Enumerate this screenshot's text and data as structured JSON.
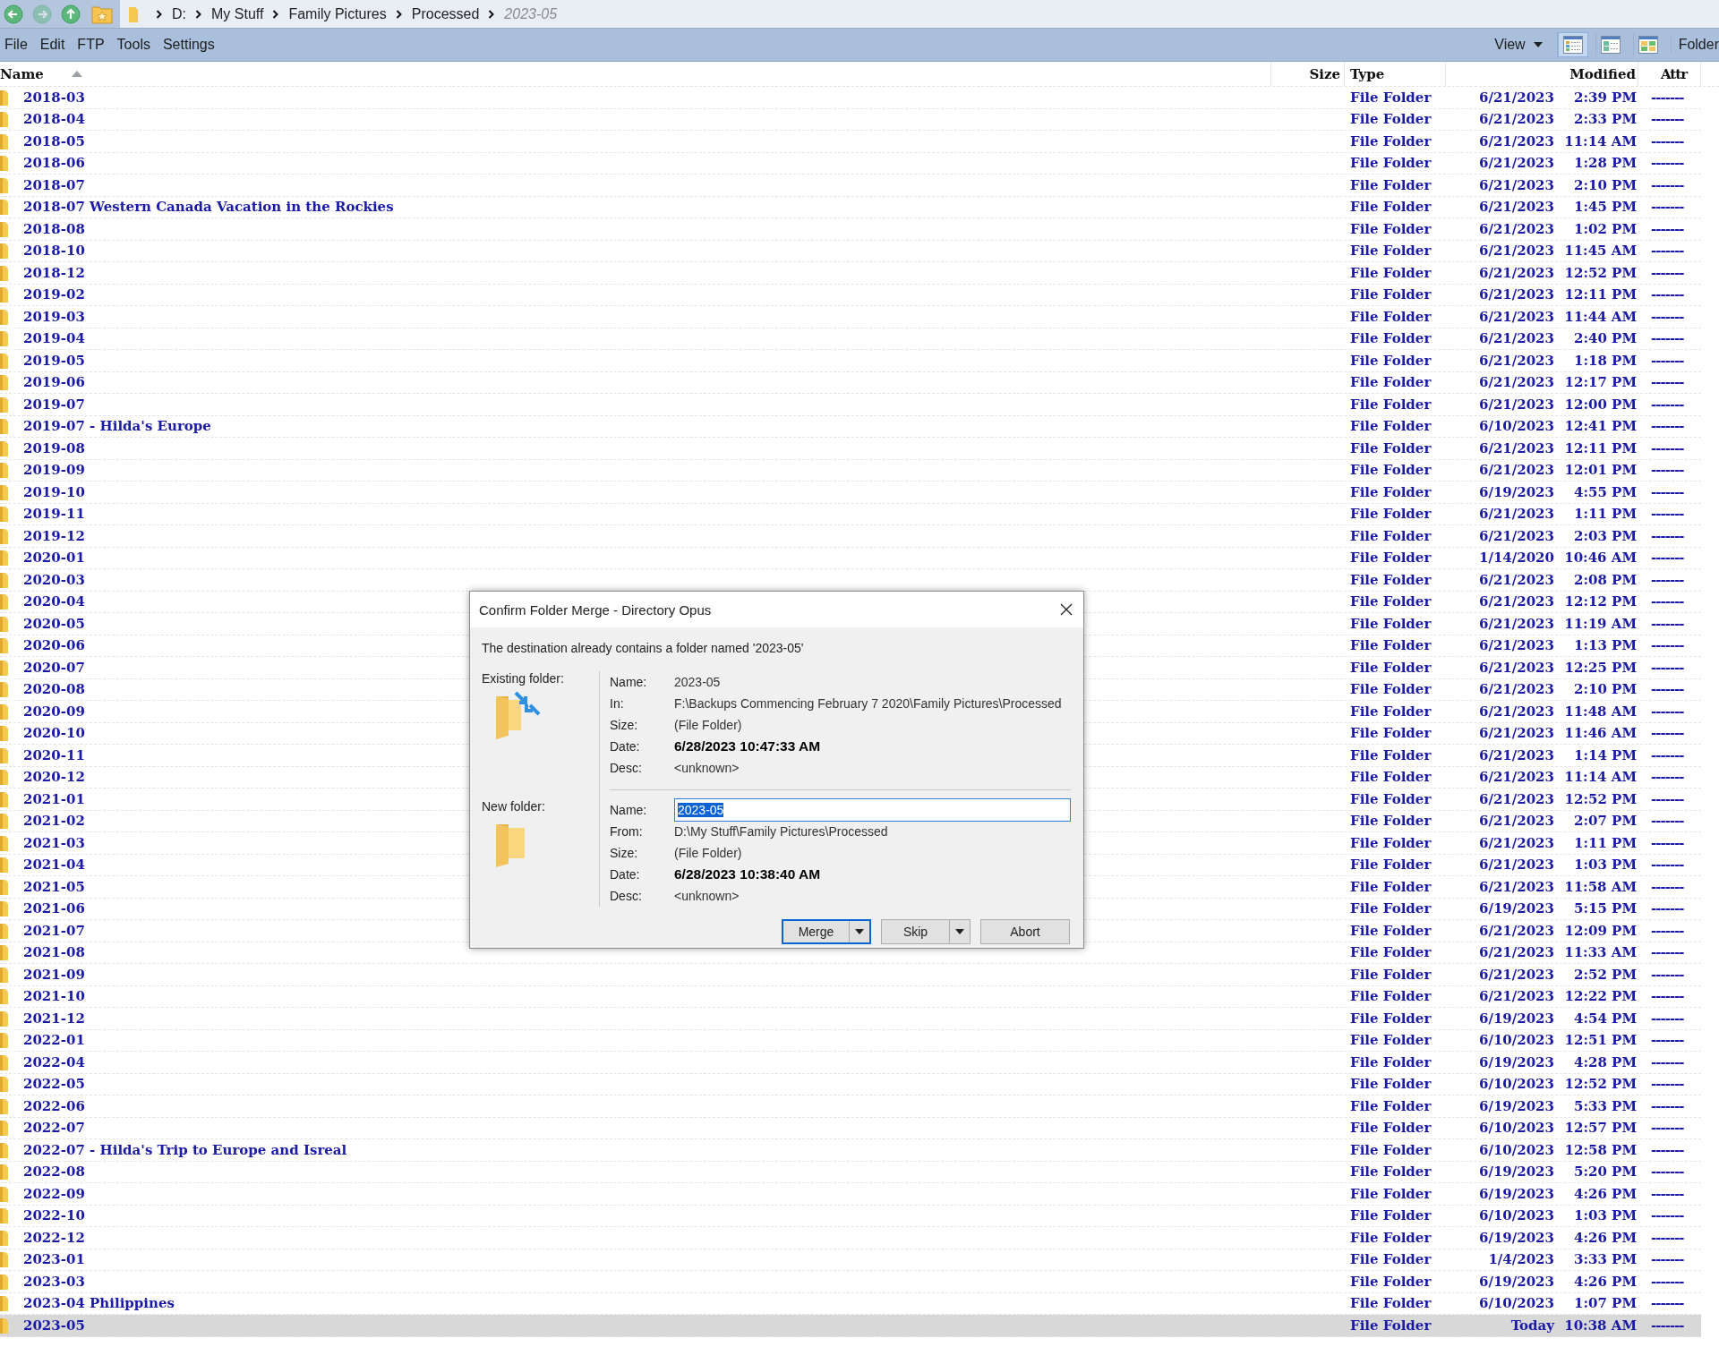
{
  "toolbar": {
    "buttons": [
      {
        "kind": "back",
        "disabled": false
      },
      {
        "kind": "forward",
        "disabled": true
      },
      {
        "kind": "up",
        "disabled": false
      },
      {
        "kind": "favorites",
        "disabled": false
      }
    ]
  },
  "breadcrumb": [
    {
      "label": "D:",
      "current": false
    },
    {
      "label": "My Stuff",
      "current": false
    },
    {
      "label": "Family Pictures",
      "current": false
    },
    {
      "label": "Processed",
      "current": false
    },
    {
      "label": "2023-05",
      "current": true
    }
  ],
  "menu": [
    "File",
    "Edit",
    "FTP",
    "Tools",
    "Settings"
  ],
  "view_menu": "View",
  "layouts": [
    {
      "kind": "details",
      "selected": true
    },
    {
      "kind": "power",
      "selected": false
    },
    {
      "kind": "thumbnails",
      "selected": false
    }
  ],
  "folder_button": "Folder",
  "columns": [
    {
      "kind": "name",
      "label": "Name",
      "sorted": true
    },
    {
      "kind": "size",
      "label": "Size",
      "sorted": false
    },
    {
      "kind": "type",
      "label": "Type",
      "sorted": false
    },
    {
      "kind": "modified",
      "label": "Modified",
      "sorted": false
    },
    {
      "kind": "attr",
      "label": "Attr",
      "sorted": false
    }
  ],
  "rows": [
    {
      "name": "2018-03",
      "type": "File Folder",
      "date": "6/21/2023",
      "time": "2:39 PM",
      "attr": "-------",
      "selected": false
    },
    {
      "name": "2018-04",
      "type": "File Folder",
      "date": "6/21/2023",
      "time": "2:33 PM",
      "attr": "-------",
      "selected": false
    },
    {
      "name": "2018-05",
      "type": "File Folder",
      "date": "6/21/2023",
      "time": "11:14 AM",
      "attr": "-------",
      "selected": false
    },
    {
      "name": "2018-06",
      "type": "File Folder",
      "date": "6/21/2023",
      "time": "1:28 PM",
      "attr": "-------",
      "selected": false
    },
    {
      "name": "2018-07",
      "type": "File Folder",
      "date": "6/21/2023",
      "time": "2:10 PM",
      "attr": "-------",
      "selected": false
    },
    {
      "name": "2018-07 Western Canada Vacation in the Rockies",
      "type": "File Folder",
      "date": "6/21/2023",
      "time": "1:45 PM",
      "attr": "-------",
      "selected": false
    },
    {
      "name": "2018-08",
      "type": "File Folder",
      "date": "6/21/2023",
      "time": "1:02 PM",
      "attr": "-------",
      "selected": false
    },
    {
      "name": "2018-10",
      "type": "File Folder",
      "date": "6/21/2023",
      "time": "11:45 AM",
      "attr": "-------",
      "selected": false
    },
    {
      "name": "2018-12",
      "type": "File Folder",
      "date": "6/21/2023",
      "time": "12:52 PM",
      "attr": "-------",
      "selected": false
    },
    {
      "name": "2019-02",
      "type": "File Folder",
      "date": "6/21/2023",
      "time": "12:11 PM",
      "attr": "-------",
      "selected": false
    },
    {
      "name": "2019-03",
      "type": "File Folder",
      "date": "6/21/2023",
      "time": "11:44 AM",
      "attr": "-------",
      "selected": false
    },
    {
      "name": "2019-04",
      "type": "File Folder",
      "date": "6/21/2023",
      "time": "2:40 PM",
      "attr": "-------",
      "selected": false
    },
    {
      "name": "2019-05",
      "type": "File Folder",
      "date": "6/21/2023",
      "time": "1:18 PM",
      "attr": "-------",
      "selected": false
    },
    {
      "name": "2019-06",
      "type": "File Folder",
      "date": "6/21/2023",
      "time": "12:17 PM",
      "attr": "-------",
      "selected": false
    },
    {
      "name": "2019-07",
      "type": "File Folder",
      "date": "6/21/2023",
      "time": "12:00 PM",
      "attr": "-------",
      "selected": false
    },
    {
      "name": "2019-07 - Hilda's Europe",
      "type": "File Folder",
      "date": "6/10/2023",
      "time": "12:41 PM",
      "attr": "-------",
      "selected": false
    },
    {
      "name": "2019-08",
      "type": "File Folder",
      "date": "6/21/2023",
      "time": "12:11 PM",
      "attr": "-------",
      "selected": false
    },
    {
      "name": "2019-09",
      "type": "File Folder",
      "date": "6/21/2023",
      "time": "12:01 PM",
      "attr": "-------",
      "selected": false
    },
    {
      "name": "2019-10",
      "type": "File Folder",
      "date": "6/19/2023",
      "time": "4:55 PM",
      "attr": "-------",
      "selected": false
    },
    {
      "name": "2019-11",
      "type": "File Folder",
      "date": "6/21/2023",
      "time": "1:11 PM",
      "attr": "-------",
      "selected": false
    },
    {
      "name": "2019-12",
      "type": "File Folder",
      "date": "6/21/2023",
      "time": "2:03 PM",
      "attr": "-------",
      "selected": false
    },
    {
      "name": "2020-01",
      "type": "File Folder",
      "date": "1/14/2020",
      "time": "10:46 AM",
      "attr": "-------",
      "selected": false
    },
    {
      "name": "2020-03",
      "type": "File Folder",
      "date": "6/21/2023",
      "time": "2:08 PM",
      "attr": "-------",
      "selected": false
    },
    {
      "name": "2020-04",
      "type": "File Folder",
      "date": "6/21/2023",
      "time": "12:12 PM",
      "attr": "-------",
      "selected": false
    },
    {
      "name": "2020-05",
      "type": "File Folder",
      "date": "6/21/2023",
      "time": "11:19 AM",
      "attr": "-------",
      "selected": false
    },
    {
      "name": "2020-06",
      "type": "File Folder",
      "date": "6/21/2023",
      "time": "1:13 PM",
      "attr": "-------",
      "selected": false
    },
    {
      "name": "2020-07",
      "type": "File Folder",
      "date": "6/21/2023",
      "time": "12:25 PM",
      "attr": "-------",
      "selected": false
    },
    {
      "name": "2020-08",
      "type": "File Folder",
      "date": "6/21/2023",
      "time": "2:10 PM",
      "attr": "-------",
      "selected": false
    },
    {
      "name": "2020-09",
      "type": "File Folder",
      "date": "6/21/2023",
      "time": "11:48 AM",
      "attr": "-------",
      "selected": false
    },
    {
      "name": "2020-10",
      "type": "File Folder",
      "date": "6/21/2023",
      "time": "11:46 AM",
      "attr": "-------",
      "selected": false
    },
    {
      "name": "2020-11",
      "type": "File Folder",
      "date": "6/21/2023",
      "time": "1:14 PM",
      "attr": "-------",
      "selected": false
    },
    {
      "name": "2020-12",
      "type": "File Folder",
      "date": "6/21/2023",
      "time": "11:14 AM",
      "attr": "-------",
      "selected": false
    },
    {
      "name": "2021-01",
      "type": "File Folder",
      "date": "6/21/2023",
      "time": "12:52 PM",
      "attr": "-------",
      "selected": false
    },
    {
      "name": "2021-02",
      "type": "File Folder",
      "date": "6/21/2023",
      "time": "2:07 PM",
      "attr": "-------",
      "selected": false
    },
    {
      "name": "2021-03",
      "type": "File Folder",
      "date": "6/21/2023",
      "time": "1:11 PM",
      "attr": "-------",
      "selected": false
    },
    {
      "name": "2021-04",
      "type": "File Folder",
      "date": "6/21/2023",
      "time": "1:03 PM",
      "attr": "-------",
      "selected": false
    },
    {
      "name": "2021-05",
      "type": "File Folder",
      "date": "6/21/2023",
      "time": "11:58 AM",
      "attr": "-------",
      "selected": false
    },
    {
      "name": "2021-06",
      "type": "File Folder",
      "date": "6/19/2023",
      "time": "5:15 PM",
      "attr": "-------",
      "selected": false
    },
    {
      "name": "2021-07",
      "type": "File Folder",
      "date": "6/21/2023",
      "time": "12:09 PM",
      "attr": "-------",
      "selected": false
    },
    {
      "name": "2021-08",
      "type": "File Folder",
      "date": "6/21/2023",
      "time": "11:33 AM",
      "attr": "-------",
      "selected": false
    },
    {
      "name": "2021-09",
      "type": "File Folder",
      "date": "6/21/2023",
      "time": "2:52 PM",
      "attr": "-------",
      "selected": false
    },
    {
      "name": "2021-10",
      "type": "File Folder",
      "date": "6/21/2023",
      "time": "12:22 PM",
      "attr": "-------",
      "selected": false
    },
    {
      "name": "2021-12",
      "type": "File Folder",
      "date": "6/19/2023",
      "time": "4:54 PM",
      "attr": "-------",
      "selected": false
    },
    {
      "name": "2022-01",
      "type": "File Folder",
      "date": "6/10/2023",
      "time": "12:51 PM",
      "attr": "-------",
      "selected": false
    },
    {
      "name": "2022-04",
      "type": "File Folder",
      "date": "6/19/2023",
      "time": "4:28 PM",
      "attr": "-------",
      "selected": false
    },
    {
      "name": "2022-05",
      "type": "File Folder",
      "date": "6/10/2023",
      "time": "12:52 PM",
      "attr": "-------",
      "selected": false
    },
    {
      "name": "2022-06",
      "type": "File Folder",
      "date": "6/19/2023",
      "time": "5:33 PM",
      "attr": "-------",
      "selected": false
    },
    {
      "name": "2022-07",
      "type": "File Folder",
      "date": "6/10/2023",
      "time": "12:57 PM",
      "attr": "-------",
      "selected": false
    },
    {
      "name": "2022-07 - Hilda's Trip to Europe and Isreal",
      "type": "File Folder",
      "date": "6/10/2023",
      "time": "12:58 PM",
      "attr": "-------",
      "selected": false
    },
    {
      "name": "2022-08",
      "type": "File Folder",
      "date": "6/19/2023",
      "time": "5:20 PM",
      "attr": "-------",
      "selected": false
    },
    {
      "name": "2022-09",
      "type": "File Folder",
      "date": "6/19/2023",
      "time": "4:26 PM",
      "attr": "-------",
      "selected": false
    },
    {
      "name": "2022-10",
      "type": "File Folder",
      "date": "6/10/2023",
      "time": "1:03 PM",
      "attr": "-------",
      "selected": false
    },
    {
      "name": "2022-12",
      "type": "File Folder",
      "date": "6/19/2023",
      "time": "4:26 PM",
      "attr": "-------",
      "selected": false
    },
    {
      "name": "2023-01",
      "type": "File Folder",
      "date": "1/4/2023",
      "time": "3:33 PM",
      "attr": "-------",
      "selected": false
    },
    {
      "name": "2023-03",
      "type": "File Folder",
      "date": "6/19/2023",
      "time": "4:26 PM",
      "attr": "-------",
      "selected": false
    },
    {
      "name": "2023-04 Philippines",
      "type": "File Folder",
      "date": "6/10/2023",
      "time": "1:07 PM",
      "attr": "-------",
      "selected": false
    },
    {
      "name": "2023-05",
      "type": "File Folder",
      "date": "Today",
      "time": "10:38 AM",
      "attr": "-------",
      "selected": true
    }
  ],
  "dialog": {
    "title": "Confirm Folder Merge - Directory Opus",
    "message": "The destination already contains a folder named '2023-05'",
    "sections": [
      {
        "kind": "existing",
        "label": "Existing folder:",
        "fields": [
          {
            "label": "Name:",
            "value": "2023-05",
            "kind": "text",
            "emphasis": false
          },
          {
            "label": "In:",
            "value": "F:\\Backups Commencing February 7 2020\\Family Pictures\\Processed",
            "kind": "text",
            "emphasis": false
          },
          {
            "label": "Size:",
            "value": "(File Folder)",
            "kind": "text",
            "emphasis": false
          },
          {
            "label": "Date:",
            "value": "6/28/2023 10:47:33 AM",
            "kind": "text",
            "emphasis": true
          },
          {
            "label": "Desc:",
            "value": "<unknown>",
            "kind": "text",
            "emphasis": false
          }
        ]
      },
      {
        "kind": "new",
        "label": "New folder:",
        "fields": [
          {
            "label": "Name:",
            "value": "2023-05",
            "kind": "input"
          },
          {
            "label": "From:",
            "value": "D:\\My Stuff\\Family Pictures\\Processed",
            "kind": "text",
            "emphasis": false
          },
          {
            "label": "Size:",
            "value": "(File Folder)",
            "kind": "text",
            "emphasis": false
          },
          {
            "label": "Date:",
            "value": "6/28/2023 10:38:40 AM",
            "kind": "text",
            "emphasis": true
          },
          {
            "label": "Desc:",
            "value": "<unknown>",
            "kind": "text",
            "emphasis": false
          }
        ]
      }
    ],
    "buttons": [
      {
        "label": "Merge",
        "dropdown": true,
        "default": true
      },
      {
        "label": "Skip",
        "dropdown": true,
        "default": false
      },
      {
        "label": "Abort",
        "dropdown": false,
        "default": false
      }
    ]
  }
}
